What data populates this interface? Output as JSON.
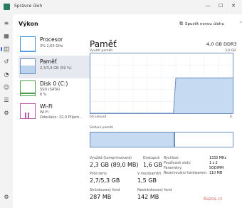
{
  "app": {
    "title": "Správce úloh"
  },
  "window_controls": {
    "minimize": "—",
    "maximize": "☐",
    "close": "✕"
  },
  "rail_icons": [
    "menu-icon",
    "processes-icon",
    "performance-icon",
    "app-history-icon",
    "startup-icon",
    "users-icon",
    "details-icon",
    "services-icon",
    "settings-icon"
  ],
  "header": {
    "title": "Výkon",
    "run_task": "Spustit novou úlohu",
    "more": "···"
  },
  "sidebar": {
    "items": [
      {
        "name": "Procesor",
        "sub1": "3% 2,63 GHz",
        "sub2": ""
      },
      {
        "name": "Paměť",
        "sub1": "2,3/3,9 GB (59 %)",
        "sub2": ""
      },
      {
        "name": "Disk 0 (C:)",
        "sub1": "SSD (SATA)",
        "sub2": "6 %"
      },
      {
        "name": "Wi-Fi",
        "sub1": "Wi-Fi",
        "sub2": "Odesláno: 32,0 Přijem..."
      }
    ]
  },
  "panel": {
    "title": "Paměť",
    "model": "4,0 GB DDR3",
    "usage_label": "Využití paměti",
    "usage_max": "3,9 GB",
    "time_left": "60 sekund",
    "time_right": "0",
    "composition_label": "Složení paměti"
  },
  "stats": {
    "in_use_label": "Využitá (komprimovaná)",
    "in_use_value": "2,3 GB (89,0 MB)",
    "available_label": "Dostupná",
    "available_value": "1,6 GB",
    "committed_label": "Potvrzeno",
    "committed_value": "2,7/5,3 GB",
    "cached_label": "V mezipaměti",
    "cached_value": "1,5 GB",
    "paged_label": "Stránkovaný fond",
    "paged_value": "287 MB",
    "nonpaged_label": "Nestránkovaný fond",
    "nonpaged_value": "142 MB"
  },
  "details": {
    "speed_label": "Rychlost:",
    "speed_value": "1333 MHz",
    "slots_label": "Používané sloty:",
    "slots_value": "1 z 2",
    "form_label": "Parametry:",
    "form_value": "SODIMM",
    "reserved_label": "Rezervováno hardwarem:",
    "reserved_value": "110 MB"
  },
  "colors": {
    "accent": "#6b8dbf",
    "fill": "#c6daf2",
    "nav_marker": "#2d6ed1"
  },
  "chart_data": {
    "type": "area",
    "ylim": [
      0,
      3.9
    ],
    "x": [
      60,
      50,
      40,
      30,
      25,
      24,
      20,
      10,
      0
    ],
    "values": [
      0,
      0,
      0,
      0,
      0,
      2.3,
      2.3,
      2.3,
      2.3
    ]
  },
  "composition": {
    "in_use_fraction": 0.59,
    "modified_fraction": 0.005
  },
  "watermark": "Bazos.cz"
}
